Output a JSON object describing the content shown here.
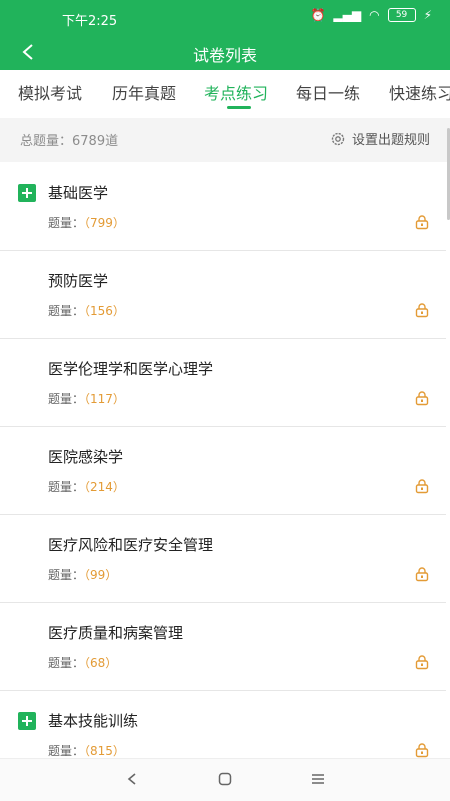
{
  "status": {
    "time": "下午2:25",
    "battery": "59"
  },
  "header": {
    "title": "试卷列表"
  },
  "tabs": [
    {
      "label": "模拟考试",
      "active": false
    },
    {
      "label": "历年真题",
      "active": false
    },
    {
      "label": "考点练习",
      "active": true
    },
    {
      "label": "每日一练",
      "active": false
    },
    {
      "label": "快速练习",
      "active": false
    }
  ],
  "summary": {
    "total": "总题量：6789道",
    "rules": "设置出题规则"
  },
  "items": [
    {
      "title": "基础医学",
      "label": "题量：",
      "count": "（799）",
      "expandable": true
    },
    {
      "title": "预防医学",
      "label": "题量：",
      "count": "（156）",
      "expandable": false
    },
    {
      "title": "医学伦理学和医学心理学",
      "label": "题量：",
      "count": "（117）",
      "expandable": false
    },
    {
      "title": "医院感染学",
      "label": "题量：",
      "count": "（214）",
      "expandable": false
    },
    {
      "title": "医疗风险和医疗安全管理",
      "label": "题量：",
      "count": "（99）",
      "expandable": false
    },
    {
      "title": "医疗质量和病案管理",
      "label": "题量：",
      "count": "（68）",
      "expandable": false
    },
    {
      "title": "基本技能训练",
      "label": "题量：",
      "count": "（815）",
      "expandable": true
    }
  ],
  "colors": {
    "accent": "#21b35b",
    "count": "#e39b36",
    "lock": "#e39b36"
  }
}
